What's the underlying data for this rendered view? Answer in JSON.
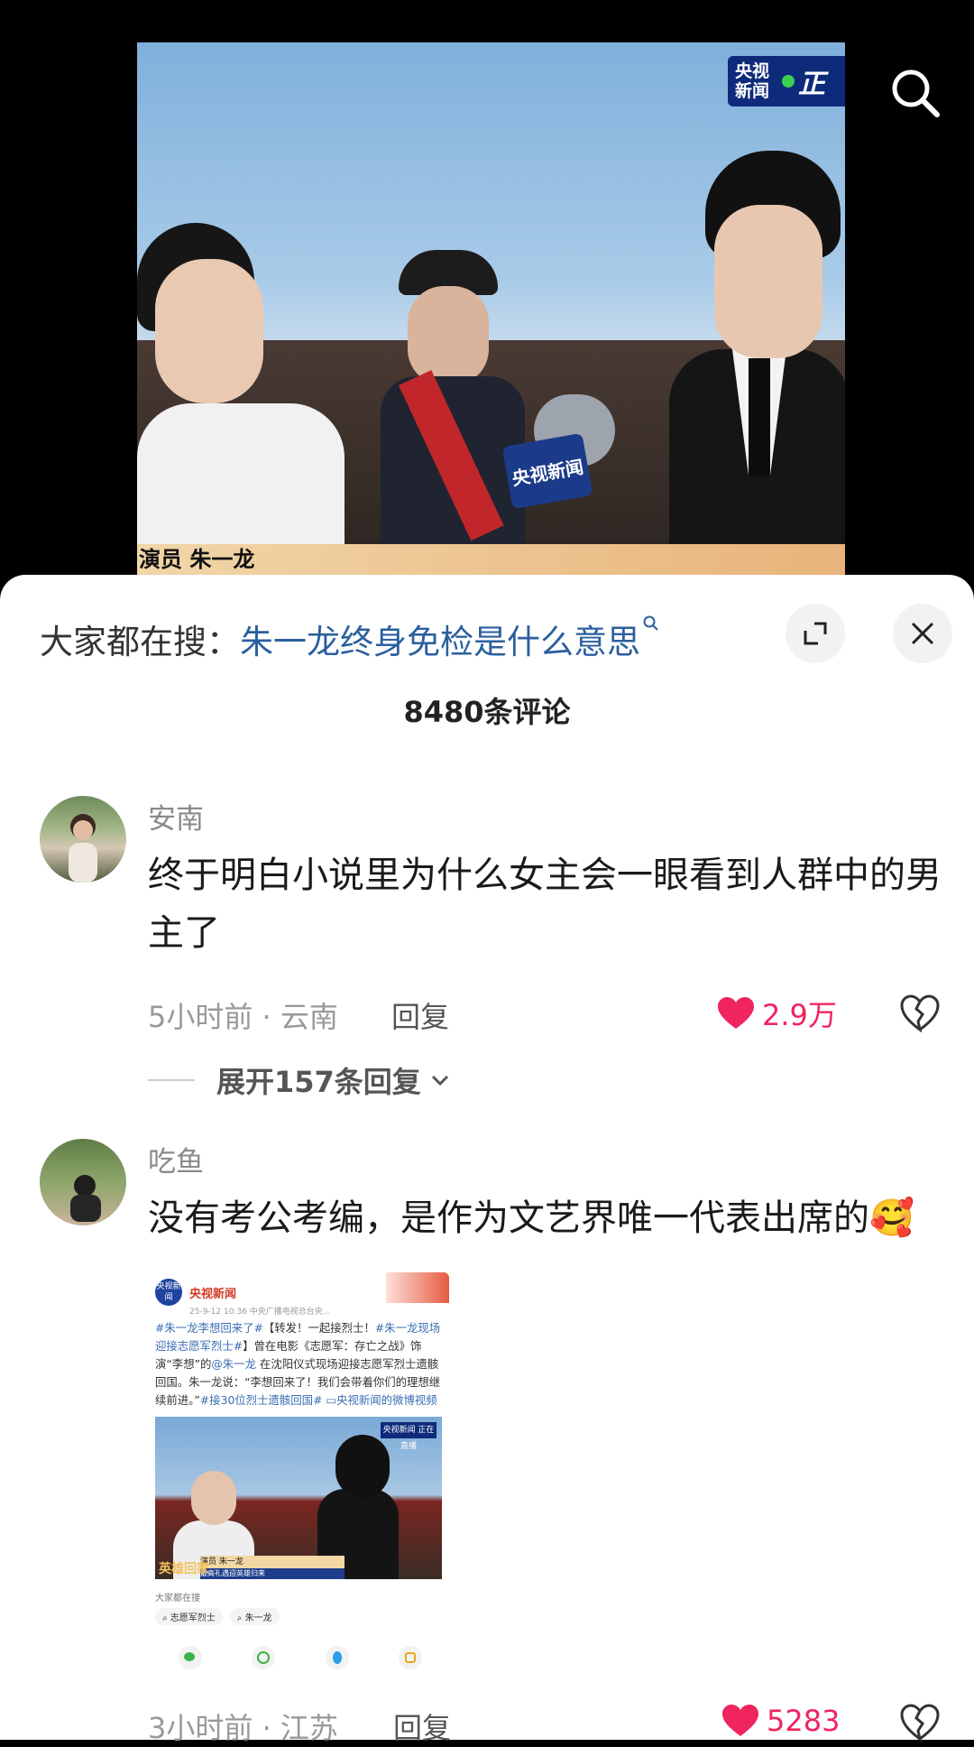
{
  "video": {
    "logo_text": "央视新闻",
    "logo_live": "正",
    "caption": "演员 朱一龙",
    "mic_flag": "央视新闻"
  },
  "hot_search": {
    "prefix": "大家都在搜：",
    "term": "朱一龙终身免检是什么意思"
  },
  "comments_title": "8480条评论",
  "comments": [
    {
      "username": "安南",
      "text": "终于明白小说里为什么女主会一眼看到人群中的男主了",
      "meta": "5小时前 · 云南",
      "reply_label": "回复",
      "likes": "2.9万",
      "expand_label": "展开157条回复"
    },
    {
      "username": "吃鱼",
      "text": "没有考公考编，是作为文艺界唯一代表出席的🥰",
      "meta": "3小时前 · 江苏",
      "reply_label": "回复",
      "likes": "5283"
    }
  ],
  "embedded_post": {
    "account": "央视新闻",
    "logo": "央视新闻",
    "time": "25-9-12 10:36 中央广播电视总台央...",
    "body_tag1": "#朱一龙李想回来了#",
    "body_text1": "【转发！一起接烈士！",
    "body_tag2": "#朱一龙现场迎接志愿军烈士#",
    "body_text2": "】曾在电影《志愿军：存亡之战》饰演“李想”的",
    "body_tag3": "@朱一龙",
    "body_text3": " 在沈阳仪式现场迎接志愿军烈士遗骸回国。朱一龙说：“李想回来了！我们会带着你们的理想继续前进。”",
    "body_tag4": "#接30位烈士遗骸回国#",
    "body_tag5": " ▭央视新闻的微博视频",
    "video_badge": "央视新闻 正在直播",
    "video_caption": "演员 朱一龙",
    "video_caption2": "最高礼遇迎英雄归来",
    "video_corner": "英雄回家",
    "search_label": "大家都在搜",
    "chips": [
      "志愿军烈士",
      "朱一龙"
    ]
  },
  "colors": {
    "like": "#f0245e",
    "link": "#2b5f9e"
  }
}
